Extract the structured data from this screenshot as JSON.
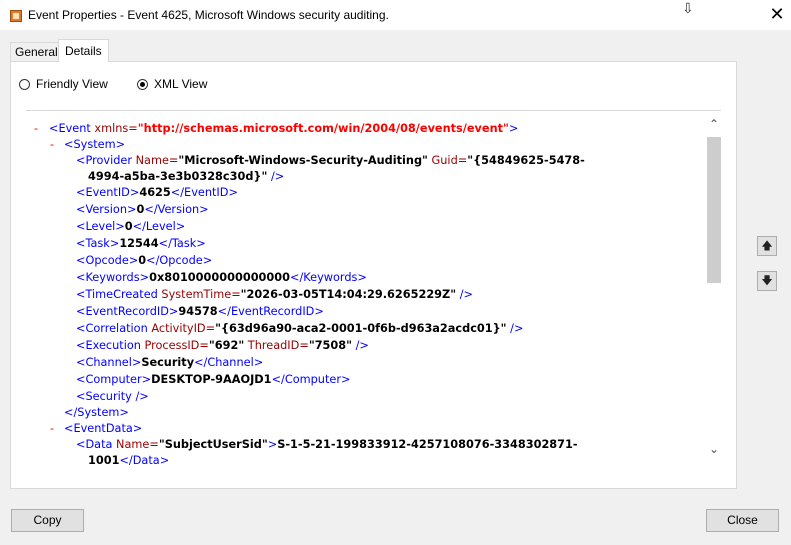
{
  "window": {
    "title": "Event Properties - Event 4625, Microsoft Windows security auditing.",
    "close_glyph": "✕"
  },
  "tabs": [
    {
      "label": "General",
      "active": false
    },
    {
      "label": "Details",
      "active": true
    }
  ],
  "view_options": {
    "friendly": {
      "label": "Friendly View",
      "selected": false
    },
    "xml": {
      "label": "XML View",
      "selected": true
    }
  },
  "xml": {
    "minus": "-",
    "event_open_tag": "<Event",
    "event_attr_name": " xmlns=",
    "event_attr_value": "\"http://schemas.microsoft.com/win/2004/08/events/event\"",
    "event_open_close": ">",
    "system_open": "<System>",
    "provider_open": "<Provider",
    "provider_name_attr": " Name=",
    "provider_name_value": "\"Microsoft-Windows-Security-Auditing\"",
    "provider_guid_attr": " Guid=",
    "provider_guid_value_1": "\"{54849625-5478-",
    "provider_guid_value_2": "4994-a5ba-3e3b0328c30d}\"",
    "provider_close": " />",
    "eventid_open": "<EventID>",
    "eventid_value": "4625",
    "eventid_close": "</EventID>",
    "version_open": "<Version>",
    "version_value": "0",
    "version_close": "</Version>",
    "level_open": "<Level>",
    "level_value": "0",
    "level_close": "</Level>",
    "task_open": "<Task>",
    "task_value": "12544",
    "task_close": "</Task>",
    "opcode_open": "<Opcode>",
    "opcode_value": "0",
    "opcode_close": "</Opcode>",
    "keywords_open": "<Keywords>",
    "keywords_value": "0x8010000000000000",
    "keywords_close": "</Keywords>",
    "timecreated_open": "<TimeCreated",
    "timecreated_attr": " SystemTime=",
    "timecreated_value": "\"2026-03-05T14:04:29.6265229Z\"",
    "timecreated_close": " />",
    "recordid_open": "<EventRecordID>",
    "recordid_value": "94578",
    "recordid_close": "</EventRecordID>",
    "correlation_open": "<Correlation",
    "correlation_attr": " ActivityID=",
    "correlation_value": "\"{63d96a90-aca2-0001-0f6b-d963a2acdc01}\"",
    "correlation_close": " />",
    "execution_open": "<Execution",
    "execution_pid_attr": " ProcessID=",
    "execution_pid_value": "\"692\"",
    "execution_tid_attr": " ThreadID=",
    "execution_tid_value": "\"7508\"",
    "execution_close": " />",
    "channel_open": "<Channel>",
    "channel_value": "Security",
    "channel_close": "</Channel>",
    "computer_open": "<Computer>",
    "computer_value": "DESKTOP-9AAOJD1",
    "computer_close": "</Computer>",
    "security_tag": "<Security />",
    "system_close": "</System>",
    "eventdata_open": "<EventData>",
    "data_open": "<Data",
    "data_attr": " Name=",
    "data_name_value": "\"SubjectUserSid\"",
    "data_open_close": ">",
    "data_value_1": "S-1-5-21-199833912-4257108076-3348302871-",
    "data_value_2": "1001",
    "data_close": "</Data>"
  },
  "scrollbar": {
    "up_glyph": "⌃",
    "down_glyph": "⌄"
  },
  "side_buttons": {
    "up_glyph": "🡅",
    "down_glyph": "🡇"
  },
  "buttons": {
    "copy": "Copy",
    "close": "Close"
  }
}
